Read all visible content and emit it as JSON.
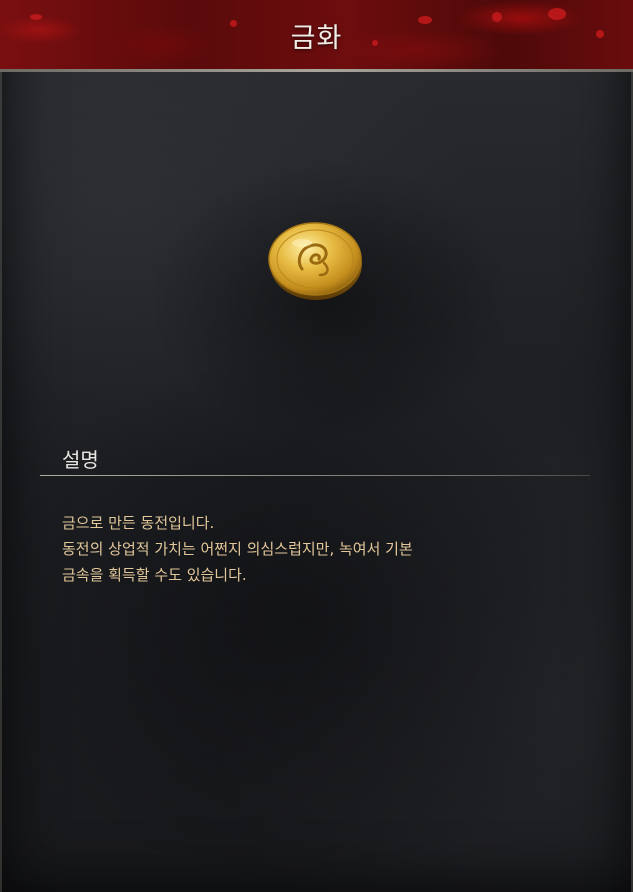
{
  "header": {
    "title": "금화"
  },
  "item": {
    "icon": "gold-coin-icon"
  },
  "description_section": {
    "heading": "설명",
    "lines": [
      "금으로 만든 동전입니다.",
      "동전의 상업적 가치는 어쩐지 의심스럽지만, 녹여서 기본",
      "금속을 획득할 수도 있습니다."
    ]
  },
  "colors": {
    "header_red": "#6d0d0e",
    "description_text": "#e2c79a",
    "heading_text": "#e8e6e1",
    "coin_gold": "#d9a82c"
  }
}
